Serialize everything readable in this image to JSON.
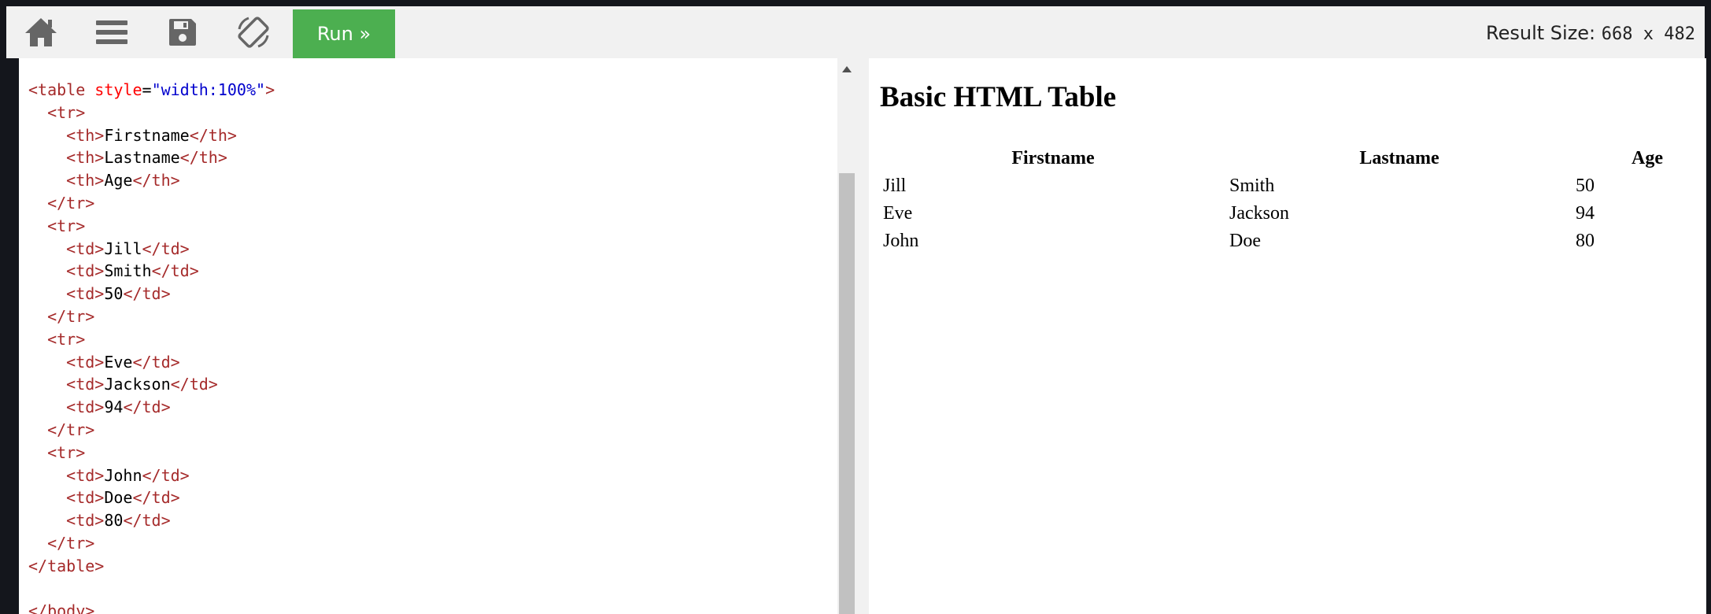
{
  "toolbar": {
    "icons": [
      "home-icon",
      "menu-icon",
      "save-icon",
      "rotate-icon"
    ],
    "run_label": "Run »",
    "result_size_label": "Result Size:",
    "result_size_value": "668 x 482"
  },
  "editor": {
    "lines": [
      [
        {
          "t": "tag",
          "v": "<table "
        },
        {
          "t": "attr",
          "v": "style"
        },
        {
          "t": "plain",
          "v": "="
        },
        {
          "t": "aval",
          "v": "\"width:100%\""
        },
        {
          "t": "tag",
          "v": ">"
        }
      ],
      [
        {
          "t": "plain",
          "v": "  "
        },
        {
          "t": "tag",
          "v": "<tr>"
        }
      ],
      [
        {
          "t": "plain",
          "v": "    "
        },
        {
          "t": "tag",
          "v": "<th>"
        },
        {
          "t": "plain",
          "v": "Firstname"
        },
        {
          "t": "tag",
          "v": "</th>"
        }
      ],
      [
        {
          "t": "plain",
          "v": "    "
        },
        {
          "t": "tag",
          "v": "<th>"
        },
        {
          "t": "plain",
          "v": "Lastname"
        },
        {
          "t": "tag",
          "v": "</th>"
        }
      ],
      [
        {
          "t": "plain",
          "v": "    "
        },
        {
          "t": "tag",
          "v": "<th>"
        },
        {
          "t": "plain",
          "v": "Age"
        },
        {
          "t": "tag",
          "v": "</th>"
        }
      ],
      [
        {
          "t": "plain",
          "v": "  "
        },
        {
          "t": "tag",
          "v": "</tr>"
        }
      ],
      [
        {
          "t": "plain",
          "v": "  "
        },
        {
          "t": "tag",
          "v": "<tr>"
        }
      ],
      [
        {
          "t": "plain",
          "v": "    "
        },
        {
          "t": "tag",
          "v": "<td>"
        },
        {
          "t": "plain",
          "v": "Jill"
        },
        {
          "t": "tag",
          "v": "</td>"
        }
      ],
      [
        {
          "t": "plain",
          "v": "    "
        },
        {
          "t": "tag",
          "v": "<td>"
        },
        {
          "t": "plain",
          "v": "Smith"
        },
        {
          "t": "tag",
          "v": "</td>"
        }
      ],
      [
        {
          "t": "plain",
          "v": "    "
        },
        {
          "t": "tag",
          "v": "<td>"
        },
        {
          "t": "plain",
          "v": "50"
        },
        {
          "t": "tag",
          "v": "</td>"
        }
      ],
      [
        {
          "t": "plain",
          "v": "  "
        },
        {
          "t": "tag",
          "v": "</tr>"
        }
      ],
      [
        {
          "t": "plain",
          "v": "  "
        },
        {
          "t": "tag",
          "v": "<tr>"
        }
      ],
      [
        {
          "t": "plain",
          "v": "    "
        },
        {
          "t": "tag",
          "v": "<td>"
        },
        {
          "t": "plain",
          "v": "Eve"
        },
        {
          "t": "tag",
          "v": "</td>"
        }
      ],
      [
        {
          "t": "plain",
          "v": "    "
        },
        {
          "t": "tag",
          "v": "<td>"
        },
        {
          "t": "plain",
          "v": "Jackson"
        },
        {
          "t": "tag",
          "v": "</td>"
        }
      ],
      [
        {
          "t": "plain",
          "v": "    "
        },
        {
          "t": "tag",
          "v": "<td>"
        },
        {
          "t": "plain",
          "v": "94"
        },
        {
          "t": "tag",
          "v": "</td>"
        }
      ],
      [
        {
          "t": "plain",
          "v": "  "
        },
        {
          "t": "tag",
          "v": "</tr>"
        }
      ],
      [
        {
          "t": "plain",
          "v": "  "
        },
        {
          "t": "tag",
          "v": "<tr>"
        }
      ],
      [
        {
          "t": "plain",
          "v": "    "
        },
        {
          "t": "tag",
          "v": "<td>"
        },
        {
          "t": "plain",
          "v": "John"
        },
        {
          "t": "tag",
          "v": "</td>"
        }
      ],
      [
        {
          "t": "plain",
          "v": "    "
        },
        {
          "t": "tag",
          "v": "<td>"
        },
        {
          "t": "plain",
          "v": "Doe"
        },
        {
          "t": "tag",
          "v": "</td>"
        }
      ],
      [
        {
          "t": "plain",
          "v": "    "
        },
        {
          "t": "tag",
          "v": "<td>"
        },
        {
          "t": "plain",
          "v": "80"
        },
        {
          "t": "tag",
          "v": "</td>"
        }
      ],
      [
        {
          "t": "plain",
          "v": "  "
        },
        {
          "t": "tag",
          "v": "</tr>"
        }
      ],
      [
        {
          "t": "tag",
          "v": "</table>"
        }
      ],
      [],
      [
        {
          "t": "tag",
          "v": "</body>"
        }
      ]
    ]
  },
  "result": {
    "heading": "Basic HTML Table",
    "table": {
      "headers": [
        "Firstname",
        "Lastname",
        "Age"
      ],
      "rows": [
        [
          "Jill",
          "Smith",
          "50"
        ],
        [
          "Eve",
          "Jackson",
          "94"
        ],
        [
          "John",
          "Doe",
          "80"
        ]
      ]
    }
  },
  "colors": {
    "run_button": "#4caf50",
    "toolbar_icon": "#666666",
    "code_tag": "#a52a2a",
    "code_attr": "#ff0000",
    "code_attr_value": "#0000cd"
  }
}
